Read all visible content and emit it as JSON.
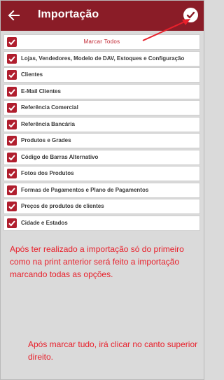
{
  "header": {
    "title": "Importação"
  },
  "select_all_label": "Marcar Todos",
  "items": [
    {
      "label": "Lojas, Vendedores, Modelo de DAV, Estoques e Configuração"
    },
    {
      "label": "Clientes"
    },
    {
      "label": "E-Mail Clientes"
    },
    {
      "label": "Referência Comercial"
    },
    {
      "label": "Referência Bancária"
    },
    {
      "label": "Produtos e Grades"
    },
    {
      "label": "Código de Barras Alternativo"
    },
    {
      "label": "Fotos dos Produtos"
    },
    {
      "label": "Formas de Pagamentos e Plano de Pagamentos"
    },
    {
      "label": "Preços de produtos de clientes"
    },
    {
      "label": "Cidade e Estados"
    }
  ],
  "annotations": {
    "note1": "Após ter realizado a importação só do primeiro como na print anterior será feito a importação marcando todas as opções.",
    "note2": "Após marcar tudo, irá clicar no canto superior direito."
  },
  "colors": {
    "appbar": "#8a1c27",
    "checkbox": "#b01e2e",
    "annotation": "#e8202b"
  },
  "icons": {
    "back": "arrow-left-icon",
    "confirm": "check-circle-icon",
    "checkbox": "checkbox-checked-icon",
    "annotation_arrow": "arrow-icon"
  }
}
